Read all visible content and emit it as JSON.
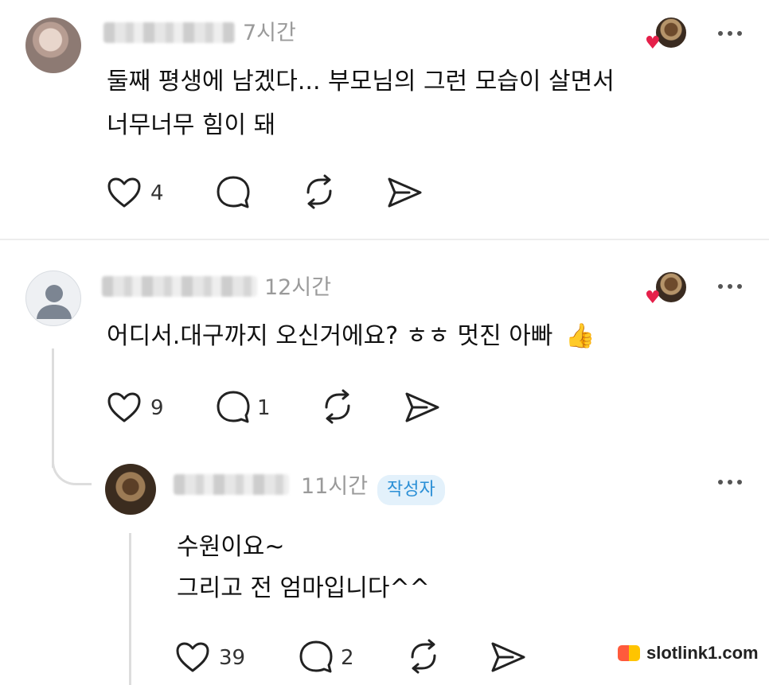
{
  "comments": [
    {
      "time": "7시간",
      "text_lines": [
        "둘째 평생에 남겠다... 부모님의 그런 모습이 살면서",
        "너무너무 힘이 돼"
      ],
      "like_count": "4",
      "reply_count": ""
    },
    {
      "time": "12시간",
      "text_lines": [
        "어디서.대구까지 오신거에요? ㅎㅎ 멋진 아빠"
      ],
      "emoji": "👍",
      "like_count": "9",
      "reply_count": "1"
    },
    {
      "time": "11시간",
      "badge": "작성자",
      "text_lines": [
        "수원이요~",
        "그리고 전 엄마입니다^^"
      ],
      "like_count": "39",
      "reply_count": "2"
    }
  ],
  "watermark": "slotlink1.com",
  "colors": {
    "heart_accent": "#e5204a",
    "badge_bg": "#e3f1fb",
    "badge_text": "#2a8fd6"
  }
}
